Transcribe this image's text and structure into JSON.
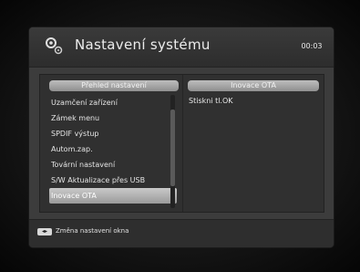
{
  "title": "Nastavení systému",
  "clock": "00:03",
  "left_panel": {
    "header": "Přehled nastavení",
    "items": [
      {
        "label": "Uzamčení zařízení",
        "selected": false
      },
      {
        "label": "Zámek menu",
        "selected": false
      },
      {
        "label": "SPDIF výstup",
        "selected": false
      },
      {
        "label": "Autom.zap.",
        "selected": false
      },
      {
        "label": "Tovární nastavení",
        "selected": false
      },
      {
        "label": "S/W Aktualizace přes USB",
        "selected": false
      },
      {
        "label": "Inovace OTA",
        "selected": true
      }
    ]
  },
  "right_panel": {
    "header": "Inovace OTA",
    "hint": "Stiskni tl.OK"
  },
  "footer": {
    "key_icon": "left-right-arrows-icon",
    "text": "Změna nastavení okna"
  }
}
